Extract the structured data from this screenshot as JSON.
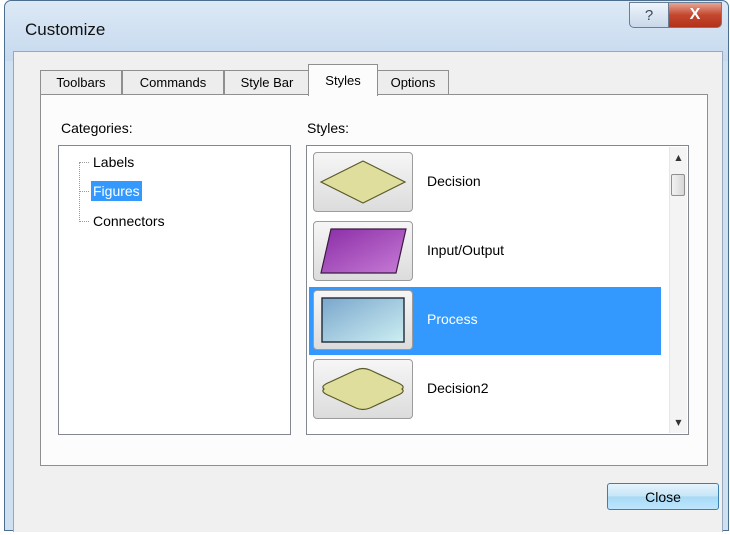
{
  "window": {
    "title": "Customize",
    "help_glyph": "?",
    "close_glyph": "X"
  },
  "tabs": [
    {
      "label": "Toolbars"
    },
    {
      "label": "Commands"
    },
    {
      "label": "Style Bar"
    },
    {
      "label": "Styles",
      "active": true
    },
    {
      "label": "Options"
    }
  ],
  "categories": {
    "label": "Categories:",
    "items": [
      {
        "label": "Labels"
      },
      {
        "label": "Figures",
        "selected": true
      },
      {
        "label": "Connectors"
      }
    ]
  },
  "styles": {
    "label": "Styles:",
    "items": [
      {
        "name": "Decision",
        "shape": "diamond-icon"
      },
      {
        "name": "Input/Output",
        "shape": "parallelogram-icon"
      },
      {
        "name": "Process",
        "shape": "rectangle-icon",
        "selected": true
      },
      {
        "name": "Decision2",
        "shape": "rounded-diamond-icon"
      }
    ]
  },
  "footer": {
    "close_label": "Close"
  },
  "colors": {
    "selection": "#3399ff",
    "decision_fill": "#e0de9c",
    "io_fill": "#a94dc0",
    "process_fill": "#a8cde0"
  }
}
